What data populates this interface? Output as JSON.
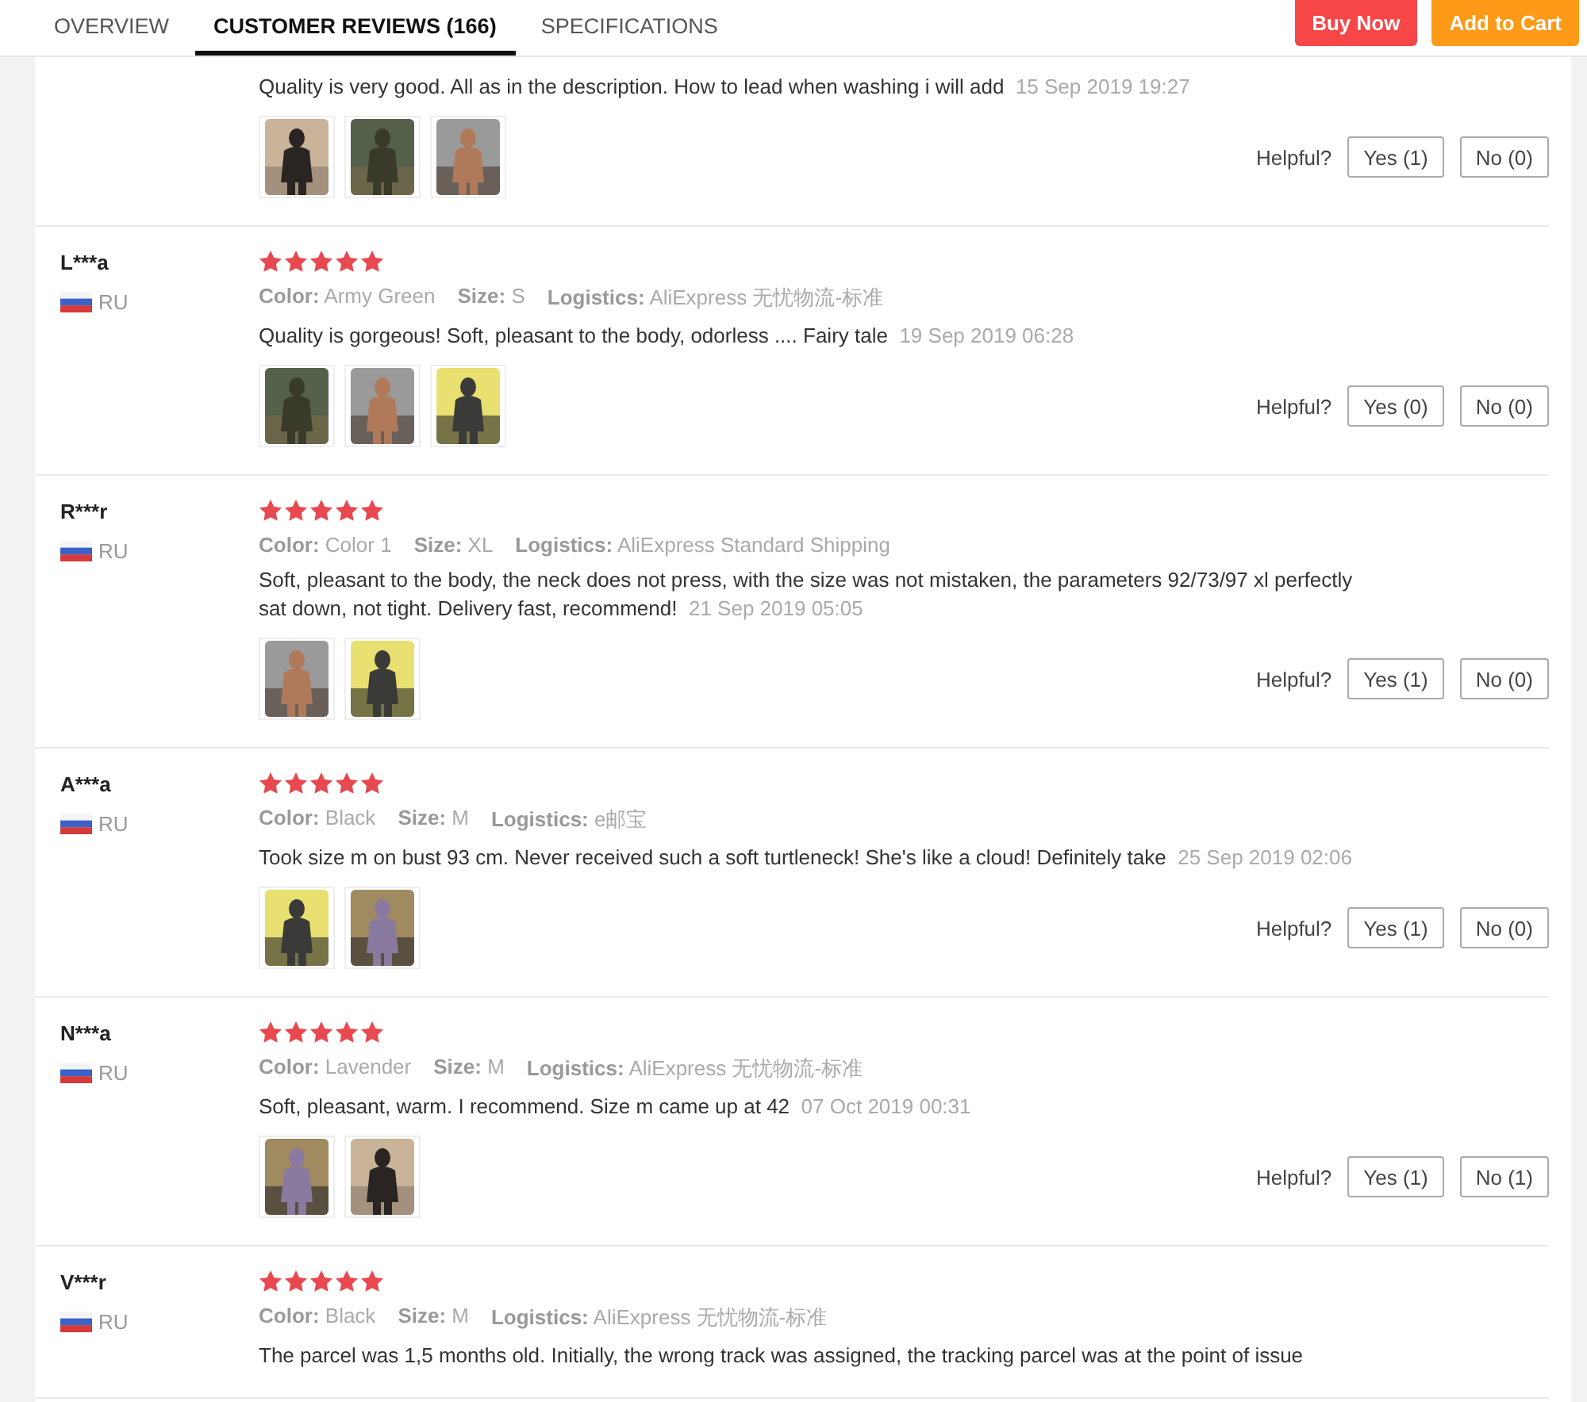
{
  "tabs": [
    {
      "label": "OVERVIEW",
      "selected": false
    },
    {
      "label": "CUSTOMER REVIEWS (166)",
      "selected": true
    },
    {
      "label": "SPECIFICATIONS",
      "selected": false
    }
  ],
  "actions": [
    {
      "label": "Buy Now",
      "kind": "buy"
    },
    {
      "label": "Add to Cart",
      "kind": "cart"
    }
  ],
  "reviews": [
    {
      "text": "Quality is very good. All as in the description. How to lead when washing i will add",
      "date": "15 Sep 2019 19:27",
      "photos": [
        {
          "kind": "picture"
        },
        {
          "kind": "picture"
        },
        {
          "kind": "picture"
        }
      ],
      "helpful_label": "Helpful?",
      "yes": "Yes (1)",
      "no": "No (0)"
    },
    {
      "author": "L***a",
      "country": "RU",
      "stars": 5,
      "attributes": [
        {
          "label": "Color:",
          "value": "Army Green"
        },
        {
          "label": "Size:",
          "value": "S"
        },
        {
          "label": "Logistics:",
          "value": "AliExpress 无忧物流-标准"
        }
      ],
      "text": "Quality is gorgeous! Soft, pleasant to the body, odorless .... Fairy tale",
      "date": "19 Sep 2019 06:28",
      "photos": [
        {
          "kind": "picture"
        },
        {
          "kind": "picture"
        },
        {
          "kind": "picture"
        }
      ],
      "helpful_label": "Helpful?",
      "yes": "Yes (0)",
      "no": "No (0)"
    },
    {
      "author": "R***r",
      "country": "RU",
      "stars": 5,
      "attributes": [
        {
          "label": "Color:",
          "value": "Color 1"
        },
        {
          "label": "Size:",
          "value": "XL"
        },
        {
          "label": "Logistics:",
          "value": "AliExpress Standard Shipping"
        }
      ],
      "text": "Soft, pleasant to the body, the neck does not press, with the size was not mistaken, the parameters 92/73/97 xl perfectly sat down, not tight. Delivery fast, recommend!",
      "date": "21 Sep 2019 05:05",
      "photos": [
        {
          "kind": "picture"
        },
        {
          "kind": "picture"
        }
      ],
      "helpful_label": "Helpful?",
      "yes": "Yes (1)",
      "no": "No (0)"
    },
    {
      "author": "A***a",
      "country": "RU",
      "stars": 5,
      "attributes": [
        {
          "label": "Color:",
          "value": "Black"
        },
        {
          "label": "Size:",
          "value": "M"
        },
        {
          "label": "Logistics:",
          "value": "e邮宝"
        }
      ],
      "text": "Took size m on bust 93 cm. Never received such a soft turtleneck! She's like a cloud! Definitely take",
      "date": "25 Sep 2019 02:06",
      "photos": [
        {
          "kind": "picture"
        },
        {
          "kind": "picture"
        }
      ],
      "helpful_label": "Helpful?",
      "yes": "Yes (1)",
      "no": "No (0)"
    },
    {
      "author": "N***a",
      "country": "RU",
      "stars": 5,
      "attributes": [
        {
          "label": "Color:",
          "value": "Lavender"
        },
        {
          "label": "Size:",
          "value": "M"
        },
        {
          "label": "Logistics:",
          "value": "AliExpress 无忧物流-标准"
        }
      ],
      "text": "Soft, pleasant, warm. I recommend. Size m came up at 42",
      "date": "07 Oct 2019 00:31",
      "photos": [
        {
          "kind": "picture"
        },
        {
          "kind": "picture"
        }
      ],
      "helpful_label": "Helpful?",
      "yes": "Yes (1)",
      "no": "No (1)"
    },
    {
      "author": "V***r",
      "country": "RU",
      "stars": 5,
      "attributes": [
        {
          "label": "Color:",
          "value": "Black"
        },
        {
          "label": "Size:",
          "value": "M"
        },
        {
          "label": "Logistics:",
          "value": "AliExpress 无忧物流-标准"
        }
      ],
      "text": "The parcel was 1,5 months old. Initially, the wrong track was assigned, the tracking parcel was at the point of issue"
    }
  ]
}
